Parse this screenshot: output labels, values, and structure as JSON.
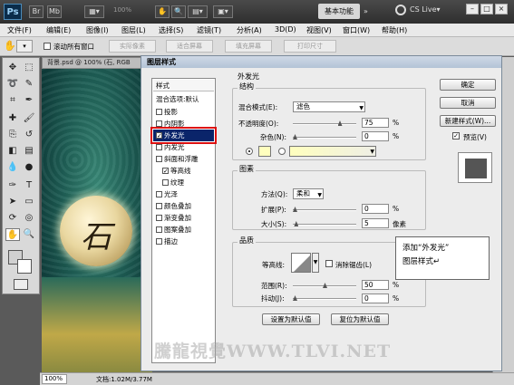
{
  "titlebar": {
    "app": "Ps",
    "zoom": "100%",
    "workspace": "基本功能",
    "cs_live": "CS Live▾",
    "icons": [
      "screen-mode-icon",
      "guides-icon",
      "zoom-level-icon",
      "hand-icon",
      "zoom-icon",
      "rotate-icon",
      "arrange-icon",
      "screen-icon"
    ]
  },
  "menubar": [
    "文件(F)",
    "编辑(E)",
    "图像(I)",
    "图层(L)",
    "选择(S)",
    "滤镜(T)",
    "分析(A)",
    "3D(D)",
    "视图(V)",
    "窗口(W)",
    "帮助(H)"
  ],
  "optionsbar": {
    "scroll_all": "滚动所有窗口",
    "buttons": [
      "实际像素",
      "适合屏幕",
      "填充屏幕",
      "打印尺寸"
    ]
  },
  "document": {
    "tab": "背景.psd @ 100% (石, RGB",
    "stone_text": "石",
    "zoom": "100%",
    "docinfo": "文档:1.02M/3.77M"
  },
  "dialog": {
    "title": "图层样式",
    "styles_header": "样式",
    "blend_options": "混合选项:默认",
    "styles": [
      {
        "label": "投影",
        "checked": false
      },
      {
        "label": "内阴影",
        "checked": false
      },
      {
        "label": "外发光",
        "checked": true,
        "selected": true
      },
      {
        "label": "内发光",
        "checked": false
      },
      {
        "label": "斜面和浮雕",
        "checked": false
      },
      {
        "label": "等高线",
        "checked": true,
        "sub": true
      },
      {
        "label": "纹理",
        "checked": false,
        "sub": true
      },
      {
        "label": "光泽",
        "checked": false
      },
      {
        "label": "颜色叠加",
        "checked": false
      },
      {
        "label": "渐变叠加",
        "checked": false
      },
      {
        "label": "图案叠加",
        "checked": false
      },
      {
        "label": "描边",
        "checked": false
      }
    ],
    "section_title": "外发光",
    "structure": {
      "title": "结构",
      "blend_mode_label": "混合模式(E):",
      "blend_mode_value": "滤色",
      "opacity_label": "不透明度(O):",
      "opacity_value": "75",
      "noise_label": "杂色(N):",
      "noise_value": "0",
      "percent": "%",
      "opacity_level": 0.75,
      "noise_level": 0,
      "glow_color": "#ffffbe"
    },
    "elements": {
      "title": "图素",
      "technique_label": "方法(Q):",
      "technique_value": "柔和",
      "spread_label": "扩展(P):",
      "spread_value": "0",
      "size_label": "大小(S):",
      "size_value": "5",
      "px": "像素",
      "spread_level": 0,
      "size_level": 0.02
    },
    "quality": {
      "title": "品质",
      "contour_label": "等高线:",
      "antialias_label": "消除锯齿(L)",
      "range_label": "范围(R):",
      "range_value": "50",
      "jitter_label": "抖动(J):",
      "jitter_value": "0",
      "range_level": 0.5,
      "jitter_level": 0
    },
    "make_default": "设置为默认值",
    "reset_default": "复位为默认值",
    "ok": "确定",
    "cancel": "取消",
    "new_style": "新建样式(W)...",
    "preview": "预览(V)"
  },
  "callout": {
    "line1": "添加“外发光”",
    "line2": "图层样式↵"
  },
  "watermark": "騰龍視覺WWW.TLVI.NET",
  "colors": {
    "selection": "#0a246a",
    "highlight_border": "#dd1111"
  }
}
